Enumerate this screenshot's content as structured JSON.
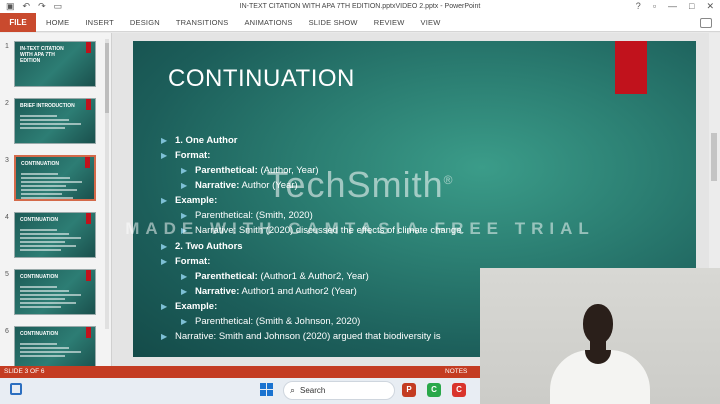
{
  "window": {
    "title": "IN-TEXT CITATION WITH APA 7TH EDITION.pptxVIDEO 2.pptx - PowerPoint",
    "quick_access_icons": [
      "save-icon",
      "undo-icon",
      "redo-icon",
      "present-icon"
    ],
    "controls": [
      "?",
      "□",
      "—",
      "□",
      "✕"
    ]
  },
  "ribbon": {
    "file": "FILE",
    "tabs": [
      "HOME",
      "INSERT",
      "DESIGN",
      "TRANSITIONS",
      "ANIMATIONS",
      "SLIDE SHOW",
      "REVIEW",
      "VIEW"
    ]
  },
  "thumbnails": [
    {
      "num": "1",
      "title": "IN-TEXT CITATION WITH APA 7TH EDITION",
      "lines": 0
    },
    {
      "num": "2",
      "title": "BRIEF INTRODUCTION",
      "lines": 4
    },
    {
      "num": "3",
      "title": "CONTINUATION",
      "lines": 8
    },
    {
      "num": "4",
      "title": "CONTINUATION",
      "lines": 6
    },
    {
      "num": "5",
      "title": "CONTINUATION",
      "lines": 6
    },
    {
      "num": "6",
      "title": "CONTINUATION",
      "lines": 4
    }
  ],
  "slide": {
    "title": "CONTINUATION",
    "accent_color": "#c1121c",
    "bullets": [
      {
        "level": 1,
        "bold": "1. One Author",
        "text": ""
      },
      {
        "level": 1,
        "bold": "Format:",
        "text": ""
      },
      {
        "level": 2,
        "bold": "Parenthetical:",
        "text": " (Author, Year)"
      },
      {
        "level": 2,
        "bold": "Narrative:",
        "text": " Author (Year)"
      },
      {
        "level": 1,
        "bold": "Example:",
        "text": ""
      },
      {
        "level": 2,
        "bold": "",
        "text": "Parenthetical: (Smith, 2020)"
      },
      {
        "level": 2,
        "bold": "",
        "text": "Narrative: Smith (2020) discussed the effects of climate change."
      },
      {
        "level": 1,
        "bold": "2. Two Authors",
        "text": ""
      },
      {
        "level": 1,
        "bold": "Format:",
        "text": ""
      },
      {
        "level": 2,
        "bold": "Parenthetical:",
        "text": " (Author1 & Author2, Year)"
      },
      {
        "level": 2,
        "bold": "Narrative:",
        "text": " Author1 and Author2 (Year)"
      },
      {
        "level": 1,
        "bold": "Example:",
        "text": ""
      },
      {
        "level": 2,
        "bold": "",
        "text": "Parenthetical: (Smith & Johnson, 2020)"
      },
      {
        "level": 1,
        "bold": "",
        "text": "Narrative: Smith and Johnson (2020) argued that biodiversity is"
      }
    ]
  },
  "watermark": {
    "logo": "TechSmith",
    "registered": "®",
    "text": "MADE WITH CAMTASIA FREE TRIAL"
  },
  "status": {
    "slide": "SLIDE 3 OF 6",
    "notes": "NOTES"
  },
  "taskbar": {
    "search_placeholder": "Search",
    "apps": [
      {
        "name": "powerpoint-icon",
        "color": "#c43c22",
        "glyph": "P"
      },
      {
        "name": "camtasia-icon",
        "color": "#2aa84a",
        "glyph": "C"
      },
      {
        "name": "camtasia-recorder-icon",
        "color": "#d9342b",
        "glyph": "C"
      }
    ]
  }
}
